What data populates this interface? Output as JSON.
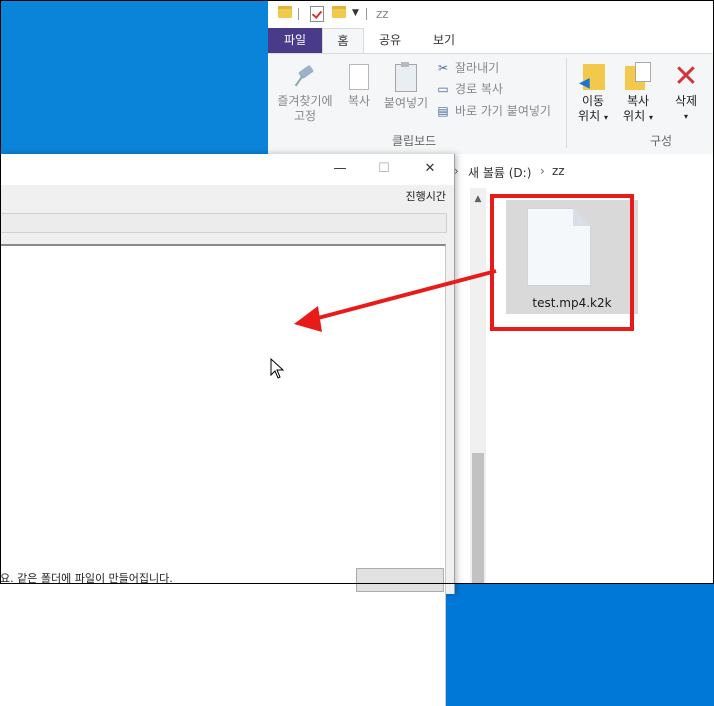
{
  "explorer": {
    "title": "zz",
    "tabs": [
      {
        "label": "파일"
      },
      {
        "label": "홈"
      },
      {
        "label": "공유"
      },
      {
        "label": "보기"
      }
    ],
    "ribbon": {
      "pin_label_1": "즐겨찾기에",
      "pin_label_2": "고정",
      "copy_label": "복사",
      "paste_label": "붙여넣기",
      "cut_label": "잘라내기",
      "copy_path_label": "경로 복사",
      "paste_shortcut_label": "바로 가기 붙여넣기",
      "clipboard_group": "클립보드",
      "move_label_1": "이동",
      "move_label_2": "위치",
      "copyto_label_1": "복사",
      "copyto_label_2": "위치",
      "delete_label": "삭제",
      "organize_group": "구성"
    },
    "address": {
      "drive": "새 볼륨 (D:)",
      "folder": "zz"
    },
    "file": {
      "name": "test.mp4.k2k"
    }
  },
  "dialog": {
    "header_col": "진행시간",
    "status_text": "요. 같은 폴더에 파일이 만들어집니다.",
    "minimize": "—",
    "maximize": "☐",
    "close": "✕"
  },
  "colors": {
    "accent_red": "#e81a1a",
    "file_tab": "#4a3a8a",
    "desktop": "#0a84d8"
  },
  "icons": [
    "folder-icon",
    "check-icon",
    "pin-icon",
    "copy-icon",
    "paste-icon",
    "scissors-icon",
    "copy-path-icon",
    "paste-shortcut-icon",
    "move-to-icon",
    "copy-to-icon",
    "delete-icon",
    "file-icon",
    "mouse-cursor-icon",
    "red-arrow"
  ]
}
